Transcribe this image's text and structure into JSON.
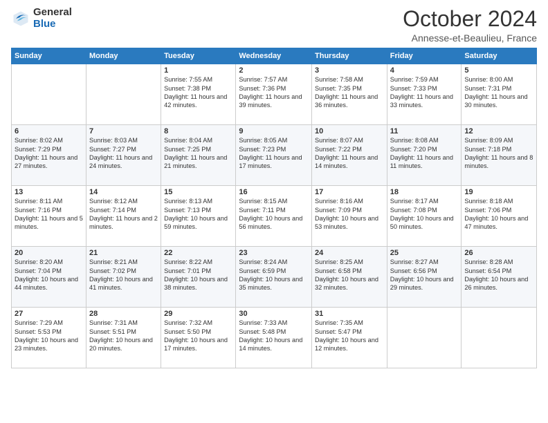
{
  "logo": {
    "general": "General",
    "blue": "Blue"
  },
  "title": "October 2024",
  "subtitle": "Annesse-et-Beaulieu, France",
  "days_of_week": [
    "Sunday",
    "Monday",
    "Tuesday",
    "Wednesday",
    "Thursday",
    "Friday",
    "Saturday"
  ],
  "weeks": [
    [
      {
        "day": "",
        "sunrise": "",
        "sunset": "",
        "daylight": ""
      },
      {
        "day": "",
        "sunrise": "",
        "sunset": "",
        "daylight": ""
      },
      {
        "day": "1",
        "sunrise": "Sunrise: 7:55 AM",
        "sunset": "Sunset: 7:38 PM",
        "daylight": "Daylight: 11 hours and 42 minutes."
      },
      {
        "day": "2",
        "sunrise": "Sunrise: 7:57 AM",
        "sunset": "Sunset: 7:36 PM",
        "daylight": "Daylight: 11 hours and 39 minutes."
      },
      {
        "day": "3",
        "sunrise": "Sunrise: 7:58 AM",
        "sunset": "Sunset: 7:35 PM",
        "daylight": "Daylight: 11 hours and 36 minutes."
      },
      {
        "day": "4",
        "sunrise": "Sunrise: 7:59 AM",
        "sunset": "Sunset: 7:33 PM",
        "daylight": "Daylight: 11 hours and 33 minutes."
      },
      {
        "day": "5",
        "sunrise": "Sunrise: 8:00 AM",
        "sunset": "Sunset: 7:31 PM",
        "daylight": "Daylight: 11 hours and 30 minutes."
      }
    ],
    [
      {
        "day": "6",
        "sunrise": "Sunrise: 8:02 AM",
        "sunset": "Sunset: 7:29 PM",
        "daylight": "Daylight: 11 hours and 27 minutes."
      },
      {
        "day": "7",
        "sunrise": "Sunrise: 8:03 AM",
        "sunset": "Sunset: 7:27 PM",
        "daylight": "Daylight: 11 hours and 24 minutes."
      },
      {
        "day": "8",
        "sunrise": "Sunrise: 8:04 AM",
        "sunset": "Sunset: 7:25 PM",
        "daylight": "Daylight: 11 hours and 21 minutes."
      },
      {
        "day": "9",
        "sunrise": "Sunrise: 8:05 AM",
        "sunset": "Sunset: 7:23 PM",
        "daylight": "Daylight: 11 hours and 17 minutes."
      },
      {
        "day": "10",
        "sunrise": "Sunrise: 8:07 AM",
        "sunset": "Sunset: 7:22 PM",
        "daylight": "Daylight: 11 hours and 14 minutes."
      },
      {
        "day": "11",
        "sunrise": "Sunrise: 8:08 AM",
        "sunset": "Sunset: 7:20 PM",
        "daylight": "Daylight: 11 hours and 11 minutes."
      },
      {
        "day": "12",
        "sunrise": "Sunrise: 8:09 AM",
        "sunset": "Sunset: 7:18 PM",
        "daylight": "Daylight: 11 hours and 8 minutes."
      }
    ],
    [
      {
        "day": "13",
        "sunrise": "Sunrise: 8:11 AM",
        "sunset": "Sunset: 7:16 PM",
        "daylight": "Daylight: 11 hours and 5 minutes."
      },
      {
        "day": "14",
        "sunrise": "Sunrise: 8:12 AM",
        "sunset": "Sunset: 7:14 PM",
        "daylight": "Daylight: 11 hours and 2 minutes."
      },
      {
        "day": "15",
        "sunrise": "Sunrise: 8:13 AM",
        "sunset": "Sunset: 7:13 PM",
        "daylight": "Daylight: 10 hours and 59 minutes."
      },
      {
        "day": "16",
        "sunrise": "Sunrise: 8:15 AM",
        "sunset": "Sunset: 7:11 PM",
        "daylight": "Daylight: 10 hours and 56 minutes."
      },
      {
        "day": "17",
        "sunrise": "Sunrise: 8:16 AM",
        "sunset": "Sunset: 7:09 PM",
        "daylight": "Daylight: 10 hours and 53 minutes."
      },
      {
        "day": "18",
        "sunrise": "Sunrise: 8:17 AM",
        "sunset": "Sunset: 7:08 PM",
        "daylight": "Daylight: 10 hours and 50 minutes."
      },
      {
        "day": "19",
        "sunrise": "Sunrise: 8:18 AM",
        "sunset": "Sunset: 7:06 PM",
        "daylight": "Daylight: 10 hours and 47 minutes."
      }
    ],
    [
      {
        "day": "20",
        "sunrise": "Sunrise: 8:20 AM",
        "sunset": "Sunset: 7:04 PM",
        "daylight": "Daylight: 10 hours and 44 minutes."
      },
      {
        "day": "21",
        "sunrise": "Sunrise: 8:21 AM",
        "sunset": "Sunset: 7:02 PM",
        "daylight": "Daylight: 10 hours and 41 minutes."
      },
      {
        "day": "22",
        "sunrise": "Sunrise: 8:22 AM",
        "sunset": "Sunset: 7:01 PM",
        "daylight": "Daylight: 10 hours and 38 minutes."
      },
      {
        "day": "23",
        "sunrise": "Sunrise: 8:24 AM",
        "sunset": "Sunset: 6:59 PM",
        "daylight": "Daylight: 10 hours and 35 minutes."
      },
      {
        "day": "24",
        "sunrise": "Sunrise: 8:25 AM",
        "sunset": "Sunset: 6:58 PM",
        "daylight": "Daylight: 10 hours and 32 minutes."
      },
      {
        "day": "25",
        "sunrise": "Sunrise: 8:27 AM",
        "sunset": "Sunset: 6:56 PM",
        "daylight": "Daylight: 10 hours and 29 minutes."
      },
      {
        "day": "26",
        "sunrise": "Sunrise: 8:28 AM",
        "sunset": "Sunset: 6:54 PM",
        "daylight": "Daylight: 10 hours and 26 minutes."
      }
    ],
    [
      {
        "day": "27",
        "sunrise": "Sunrise: 7:29 AM",
        "sunset": "Sunset: 5:53 PM",
        "daylight": "Daylight: 10 hours and 23 minutes."
      },
      {
        "day": "28",
        "sunrise": "Sunrise: 7:31 AM",
        "sunset": "Sunset: 5:51 PM",
        "daylight": "Daylight: 10 hours and 20 minutes."
      },
      {
        "day": "29",
        "sunrise": "Sunrise: 7:32 AM",
        "sunset": "Sunset: 5:50 PM",
        "daylight": "Daylight: 10 hours and 17 minutes."
      },
      {
        "day": "30",
        "sunrise": "Sunrise: 7:33 AM",
        "sunset": "Sunset: 5:48 PM",
        "daylight": "Daylight: 10 hours and 14 minutes."
      },
      {
        "day": "31",
        "sunrise": "Sunrise: 7:35 AM",
        "sunset": "Sunset: 5:47 PM",
        "daylight": "Daylight: 10 hours and 12 minutes."
      },
      {
        "day": "",
        "sunrise": "",
        "sunset": "",
        "daylight": ""
      },
      {
        "day": "",
        "sunrise": "",
        "sunset": "",
        "daylight": ""
      }
    ]
  ]
}
